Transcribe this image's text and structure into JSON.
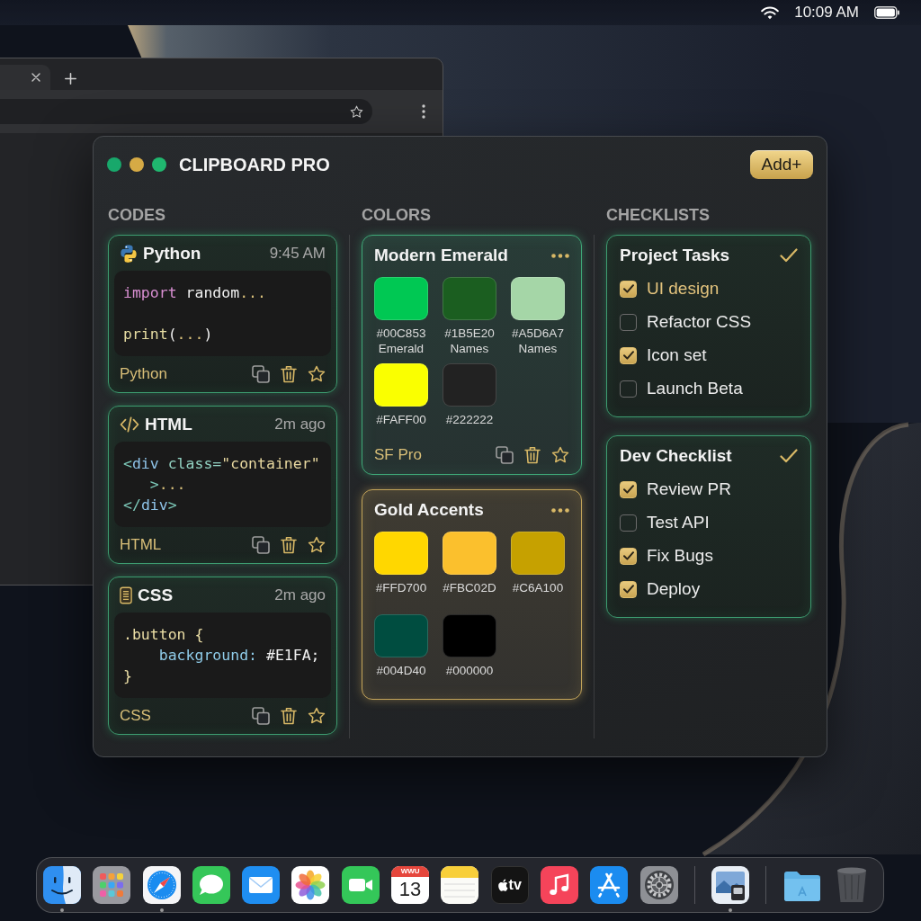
{
  "menu_bar": {
    "clock": "10:09 AM"
  },
  "window": {
    "title": "CLIPBOARD PRO",
    "controls": [
      {
        "color": "#18a86b"
      },
      {
        "color": "#d6aa45"
      },
      {
        "color": "#20b76f"
      }
    ],
    "add_button": "Add+"
  },
  "codes": {
    "heading": "CODES",
    "snippets": [
      {
        "kind": "python",
        "title": "Python",
        "time": "9:45 AM",
        "language": "Python",
        "lines": [
          {
            "kind": "code",
            "tokens": [
              {
                "text": "import",
                "kind": "keyword"
              },
              {
                "text": " random",
                "kind": "plain"
              },
              {
                "text": "...",
                "kind": "ellipsis"
              }
            ]
          },
          {
            "kind": "blank"
          },
          {
            "kind": "code",
            "tokens": [
              {
                "text": "print",
                "kind": "function"
              },
              {
                "text": "(",
                "kind": "plain"
              },
              {
                "text": "...",
                "kind": "ellipsis"
              },
              {
                "text": ")",
                "kind": "plain"
              }
            ]
          }
        ]
      },
      {
        "kind": "html",
        "title": "HTML",
        "time": "2m ago",
        "language": "HTML",
        "lines": [
          {
            "kind": "code",
            "tokens": [
              {
                "text": "<",
                "kind": "bracket"
              },
              {
                "text": "div",
                "kind": "tag"
              },
              {
                "text": " class=",
                "kind": "attribute"
              },
              {
                "text": "\"container\"",
                "kind": "string"
              }
            ]
          },
          {
            "kind": "code",
            "tokens": [
              {
                "text": "   >",
                "kind": "bracket"
              },
              {
                "text": "...",
                "kind": "ellipsis"
              }
            ]
          },
          {
            "kind": "code",
            "tokens": [
              {
                "text": "</",
                "kind": "bracket"
              },
              {
                "text": "div",
                "kind": "tag"
              },
              {
                "text": ">",
                "kind": "bracket"
              }
            ]
          }
        ]
      },
      {
        "kind": "css",
        "title": "CSS",
        "time": "2m ago",
        "language": "CSS",
        "lines": [
          {
            "kind": "code",
            "tokens": [
              {
                "text": ".button {",
                "kind": "selector"
              }
            ]
          },
          {
            "kind": "code",
            "tokens": [
              {
                "text": "    background:",
                "kind": "property"
              },
              {
                "text": " #E1FA;",
                "kind": "value"
              }
            ]
          },
          {
            "kind": "code",
            "tokens": [
              {
                "text": "}",
                "kind": "selector"
              }
            ]
          }
        ]
      }
    ]
  },
  "colors": {
    "heading": "COLORS",
    "palettes": [
      {
        "title": "Modern Emerald",
        "color": "#3fa878",
        "swatches": [
          {
            "color": "#00c853",
            "code": "#00C853",
            "name": "Emerald"
          },
          {
            "color": "#1b5e20",
            "code": "#1B5E20",
            "name": "Names"
          },
          {
            "color": "#a5d6a7",
            "code": "#A5D6A7",
            "name": "Names"
          },
          {
            "color": "#faff00",
            "code": "#FAFF00"
          },
          {
            "color": "#222222",
            "code": "#222222"
          }
        ],
        "footer_label": "SF Pro"
      },
      {
        "title": "Gold Accents",
        "color": "#c4a55a",
        "swatches": [
          {
            "color": "#ffd700",
            "code": "#FFD700"
          },
          {
            "color": "#fbc02d",
            "code": "#FBC02D"
          },
          {
            "color": "#c6a100",
            "code": "#C6A100"
          },
          {
            "color": "#004d40",
            "code": "#004D40"
          },
          {
            "color": "#000000",
            "code": "#000000"
          }
        ]
      }
    ]
  },
  "checklists": {
    "heading": "CHECKLISTS",
    "lists": [
      {
        "title": "Project Tasks",
        "items": [
          {
            "label": "UI design",
            "checked": true,
            "highlighted": true
          },
          {
            "label": "Refactor CSS",
            "checked": false,
            "highlighted": false
          },
          {
            "label": "Icon set",
            "checked": true,
            "highlighted": false
          },
          {
            "label": "Launch Beta",
            "checked": false,
            "highlighted": false
          }
        ]
      },
      {
        "title": "Dev Checklist",
        "items": [
          {
            "label": "Review PR",
            "checked": true,
            "highlighted": false
          },
          {
            "label": "Test API",
            "checked": false,
            "highlighted": false
          },
          {
            "label": "Fix Bugs",
            "checked": true,
            "highlighted": false
          },
          {
            "label": "Deploy",
            "checked": true,
            "highlighted": false
          }
        ]
      }
    ]
  },
  "dock": {
    "items": [
      {
        "kind": "finder",
        "running": true
      },
      {
        "kind": "launchpad",
        "running": false
      },
      {
        "kind": "safari",
        "running": true
      },
      {
        "kind": "messages",
        "running": false
      },
      {
        "kind": "mail",
        "running": false
      },
      {
        "kind": "photos",
        "running": false
      },
      {
        "kind": "facetime",
        "running": false
      },
      {
        "kind": "calendar",
        "running": false,
        "month": "WWU",
        "day": "13"
      },
      {
        "kind": "notes",
        "running": false
      },
      {
        "kind": "tv",
        "running": false,
        "label": "tv"
      },
      {
        "kind": "music",
        "running": false
      },
      {
        "kind": "appstore",
        "running": false
      },
      {
        "kind": "settings",
        "running": false
      },
      {
        "kind": "separator"
      },
      {
        "kind": "preview",
        "running": true
      },
      {
        "kind": "separator"
      },
      {
        "kind": "folder",
        "running": false
      },
      {
        "kind": "trash",
        "running": false
      }
    ]
  }
}
